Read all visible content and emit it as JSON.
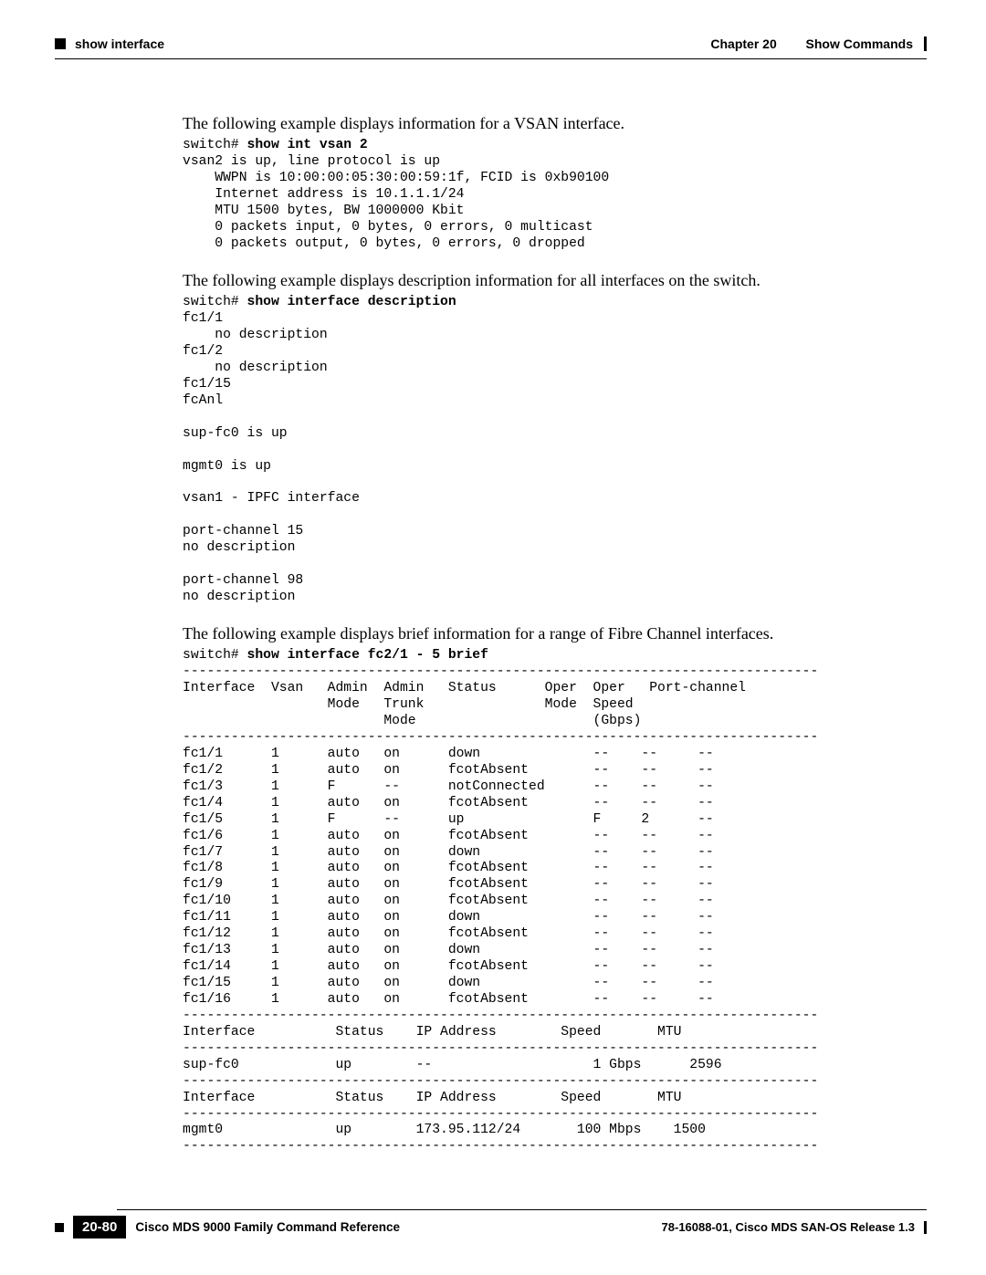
{
  "header": {
    "left": "show interface",
    "chapter": "Chapter 20",
    "right_title": "Show Commands"
  },
  "body": {
    "para1": "The following example displays information for a VSAN interface.",
    "cli1_prompt": "switch# ",
    "cli1_cmd": "show int vsan 2",
    "cli1_body": "vsan2 is up, line protocol is up\n    WWPN is 10:00:00:05:30:00:59:1f, FCID is 0xb90100\n    Internet address is 10.1.1.1/24\n    MTU 1500 bytes, BW 1000000 Kbit\n    0 packets input, 0 bytes, 0 errors, 0 multicast\n    0 packets output, 0 bytes, 0 errors, 0 dropped",
    "para2": "The following example displays description information for all interfaces on the switch.",
    "cli2_prompt": "switch# ",
    "cli2_cmd": "show interface description",
    "cli2_body": "fc1/1\n    no description\nfc1/2\n    no description\nfc1/15\nfcAnl\n\nsup-fc0 is up\n\nmgmt0 is up\n\nvsan1 - IPFC interface\n\nport-channel 15\nno description\n\nport-channel 98\nno description",
    "para3": "The following example displays brief information for a range of Fibre Channel interfaces.",
    "cli3_prompt": "switch# ",
    "cli3_cmd": "show interface fc2/1 - 5 brief",
    "cli3_body": "-------------------------------------------------------------------------------\nInterface  Vsan   Admin  Admin   Status      Oper  Oper   Port-channel\n                  Mode   Trunk               Mode  Speed\n                         Mode                      (Gbps)\n-------------------------------------------------------------------------------\nfc1/1      1      auto   on      down              --    --     --\nfc1/2      1      auto   on      fcotAbsent        --    --     --\nfc1/3      1      F      --      notConnected      --    --     --\nfc1/4      1      auto   on      fcotAbsent        --    --     --\nfc1/5      1      F      --      up                F     2      --\nfc1/6      1      auto   on      fcotAbsent        --    --     --\nfc1/7      1      auto   on      down              --    --     --\nfc1/8      1      auto   on      fcotAbsent        --    --     --\nfc1/9      1      auto   on      fcotAbsent        --    --     --\nfc1/10     1      auto   on      fcotAbsent        --    --     --\nfc1/11     1      auto   on      down              --    --     --\nfc1/12     1      auto   on      fcotAbsent        --    --     --\nfc1/13     1      auto   on      down              --    --     --\nfc1/14     1      auto   on      fcotAbsent        --    --     --\nfc1/15     1      auto   on      down              --    --     --\nfc1/16     1      auto   on      fcotAbsent        --    --     --\n-------------------------------------------------------------------------------\nInterface          Status    IP Address        Speed       MTU\n-------------------------------------------------------------------------------\nsup-fc0            up        --                    1 Gbps      2596\n-------------------------------------------------------------------------------\nInterface          Status    IP Address        Speed       MTU\n-------------------------------------------------------------------------------\nmgmt0              up        173.95.112/24       100 Mbps    1500\n-------------------------------------------------------------------------------"
  },
  "footer": {
    "page_num": "20-80",
    "book_title": "Cisco MDS 9000 Family Command Reference",
    "release": "78-16088-01, Cisco MDS SAN-OS Release 1.3"
  }
}
